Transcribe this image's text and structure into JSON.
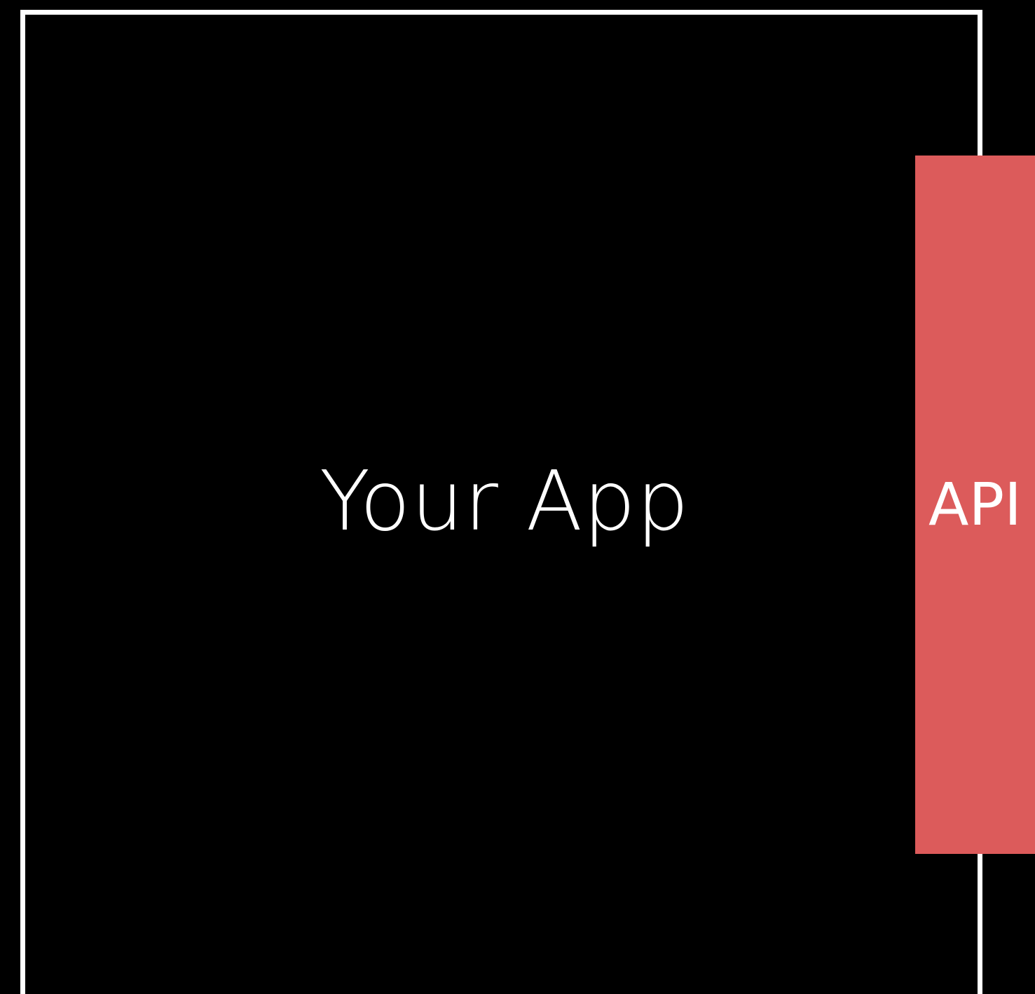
{
  "diagram": {
    "app_label": "Your App",
    "api_label": "API"
  },
  "colors": {
    "background": "#000000",
    "app_border": "#ffffff",
    "api_fill": "#dc5b5b",
    "text": "#ffffff"
  }
}
